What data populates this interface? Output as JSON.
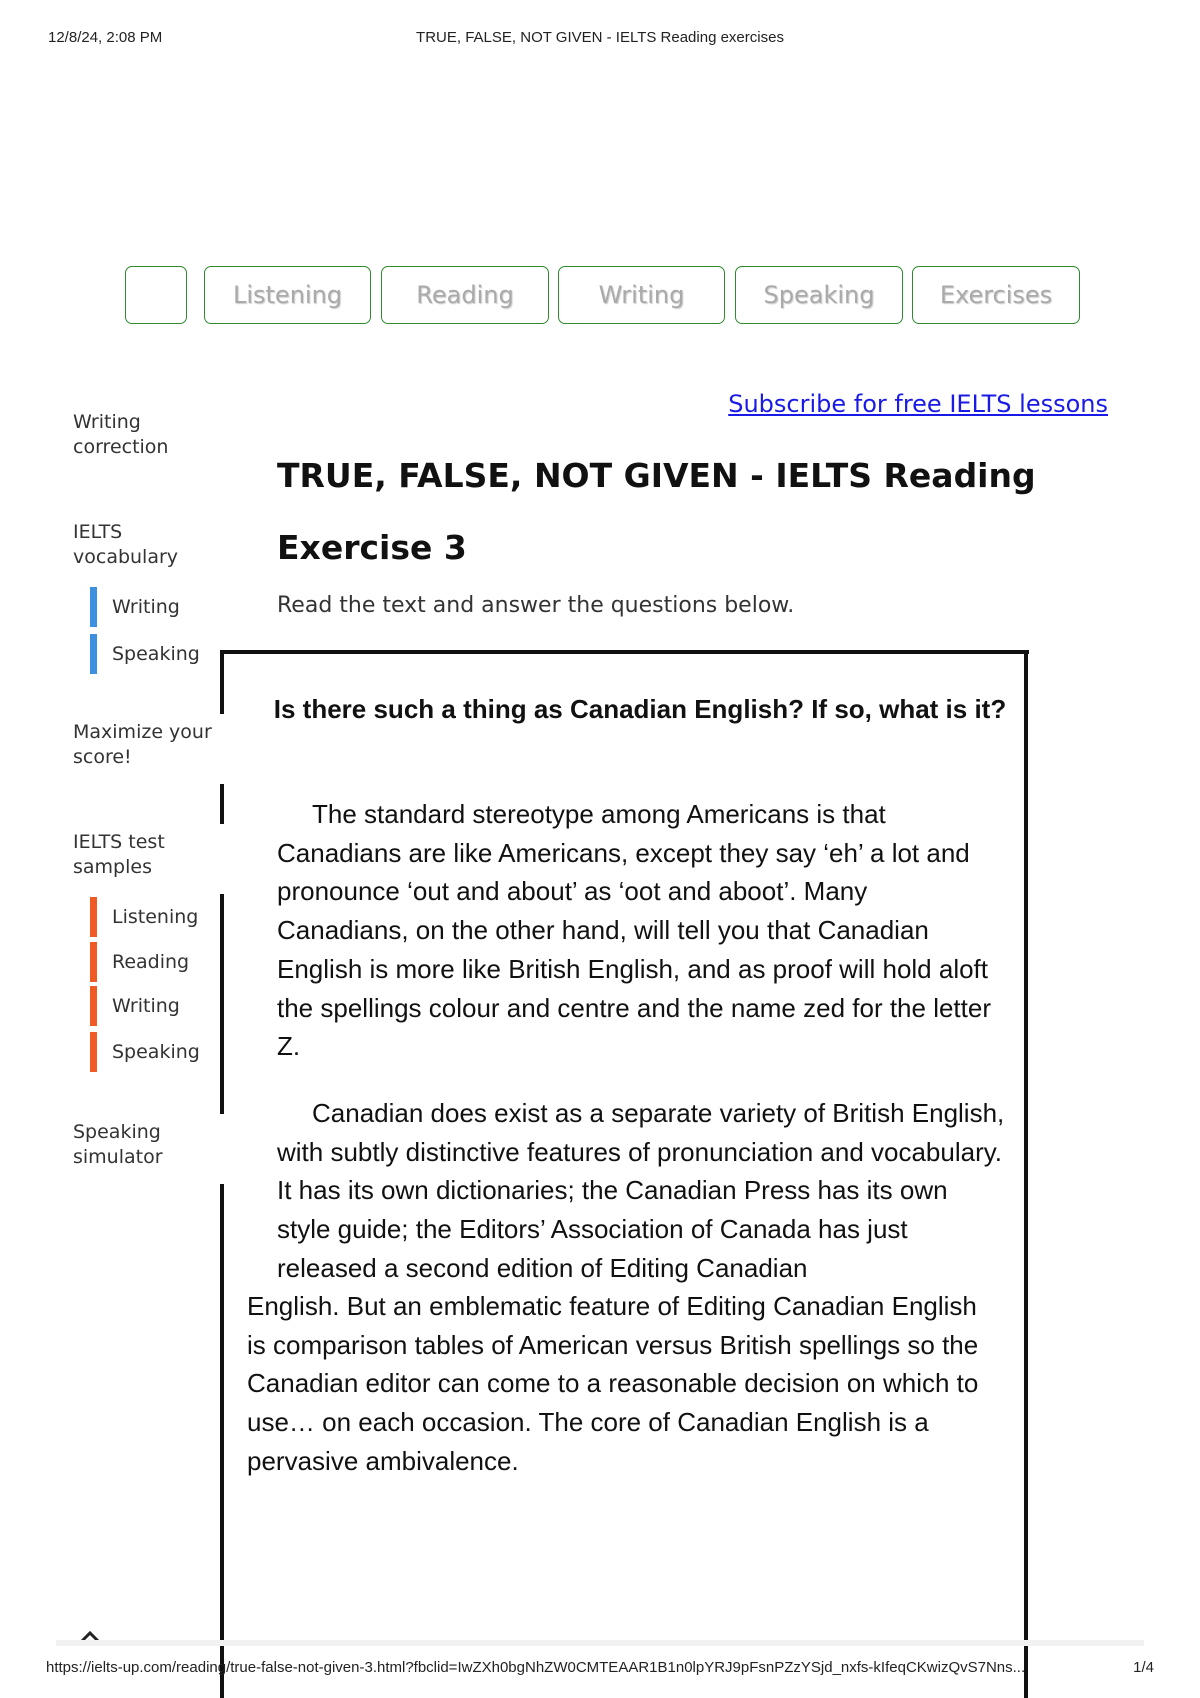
{
  "print_header": {
    "datetime": "12/8/24, 2:08 PM",
    "title": "TRUE, FALSE, NOT GIVEN - IELTS Reading exercises"
  },
  "nav": {
    "home": "",
    "items": [
      "Listening",
      "Reading",
      "Writing",
      "Speaking",
      "Exercises"
    ]
  },
  "sidebar": {
    "writing_correction": "Writing correction",
    "ielts_vocabulary": "IELTS vocabulary",
    "vocab_items": [
      "Writing",
      "Speaking"
    ],
    "maximize": "Maximize your score!",
    "test_samples": "IELTS test samples",
    "sample_items": [
      "Listening",
      "Reading",
      "Writing",
      "Speaking"
    ],
    "speaking_simulator": "Speaking simulator",
    "colors": {
      "vocab_accent": "#3d8fe0",
      "samples_accent": "#ef5b24"
    }
  },
  "subscribe_link": "Subscribe for free IELTS lessons",
  "page_title": "TRUE, FALSE, NOT GIVEN - IELTS Reading Exercise 3",
  "intro": "Read the text and answer the questions below.",
  "passage": {
    "title": "Is there such a thing as Canadian English? If so, what is it?",
    "paragraphs": [
      "The standard stereotype among Americans is that Canadians are like Americans, except they say ‘eh’ a lot and pronounce ‘out and about’ as ‘oot and aboot’. Many Canadians, on the other hand, will tell you that Canadian English is more like British English, and as proof will hold aloft the spellings colour and centre and the name zed for the letter Z.",
      "Canadian does exist as a separate variety of British English, with subtly distinctive features of pronunciation and vocabulary. It has its own dictionaries; the Canadian Press has its own style guide; the Editors’ Association of Canada has just released a second edition of Editing Canadian",
      "English. But an emblematic feature of Editing Canadian English is comparison tables of American versus British spellings so the Canadian editor can come to a reasonable decision on which to use… on each occasion. The core of Canadian English is a pervasive ambivalence."
    ]
  },
  "scroll_top_icon": "chevron-up-icon",
  "print_footer": {
    "url": "https://ielts-up.com/reading/true-false-not-given-3.html?fbclid=IwZXh0bgNhZW0CMTEAAR1B1n0lpYRJ9pFsnPZzYSjd_nxfs-kIfeqCKwizQvS7Nns...",
    "page": "1/4"
  }
}
